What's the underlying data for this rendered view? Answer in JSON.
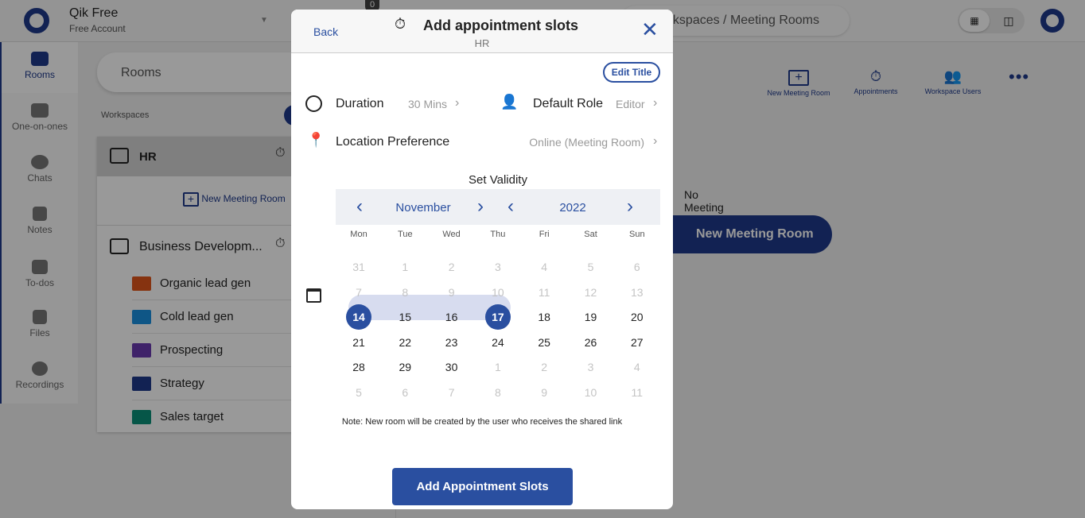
{
  "app": {
    "name": "Qik Free",
    "account": "Free Account",
    "notification_count": "0",
    "breadcrumb": "Workspaces / Meeting Rooms"
  },
  "sidebar": {
    "items": [
      {
        "label": "Rooms",
        "active": true
      },
      {
        "label": "One-on-ones"
      },
      {
        "label": "Chats"
      },
      {
        "label": "Notes"
      },
      {
        "label": "To-dos"
      },
      {
        "label": "Files"
      },
      {
        "label": "Recordings"
      }
    ]
  },
  "middle": {
    "search_placeholder": "Rooms",
    "workspaces_label": "Workspaces",
    "hr": {
      "name": "HR",
      "new_room": "New Meeting Room"
    },
    "business": {
      "name": "Business Developm...",
      "rooms": [
        {
          "label": "Organic lead gen",
          "color": "#e0561b"
        },
        {
          "label": "Cold lead gen",
          "color": "#1a8fe0"
        },
        {
          "label": "Prospecting",
          "color": "#6a3ab0"
        },
        {
          "label": "Strategy",
          "color": "#1e3a8a"
        },
        {
          "label": "Sales target",
          "color": "#0a8f78"
        }
      ]
    }
  },
  "main": {
    "actions": [
      {
        "label": "New Meeting Room",
        "icon": "plus-square-icon"
      },
      {
        "label": "Appointments",
        "icon": "appointments-icon"
      },
      {
        "label": "Workspace Users",
        "icon": "users-icon"
      }
    ],
    "empty_text": "No Meeting Rooms Yet",
    "new_room_button": "New Meeting Room"
  },
  "modal": {
    "back": "Back",
    "title": "Add appointment slots",
    "subtitle": "HR",
    "edit_title": "Edit Title",
    "duration_label": "Duration",
    "duration_value": "30 Mins",
    "role_label": "Default Role",
    "role_value": "Editor",
    "location_label": "Location Preference",
    "location_value": "Online (Meeting Room)",
    "validity_label": "Set Validity",
    "month": "November",
    "year": "2022",
    "weekdays": [
      "Mon",
      "Tue",
      "Wed",
      "Thu",
      "Fri",
      "Sat",
      "Sun"
    ],
    "weeks": [
      [
        "31",
        "1",
        "2",
        "3",
        "4",
        "5",
        "6"
      ],
      [
        "7",
        "8",
        "9",
        "10",
        "11",
        "12",
        "13"
      ],
      [
        "14",
        "15",
        "16",
        "17",
        "18",
        "19",
        "20"
      ],
      [
        "21",
        "22",
        "23",
        "24",
        "25",
        "26",
        "27"
      ],
      [
        "28",
        "29",
        "30",
        "1",
        "2",
        "3",
        "4"
      ],
      [
        "5",
        "6",
        "7",
        "8",
        "9",
        "10",
        "11"
      ]
    ],
    "range_start": "14",
    "range_end": "17",
    "note": "Note: New room will be created by the user who receives the shared link",
    "submit": "Add Appointment Slots"
  },
  "colors": {
    "accent": "#2a4fa0",
    "brand": "#1e3a8a"
  }
}
